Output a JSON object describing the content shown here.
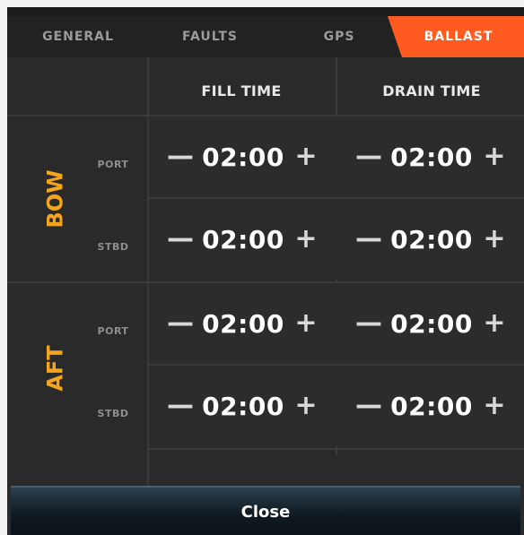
{
  "tabs": [
    {
      "label": "GENERAL",
      "active": false
    },
    {
      "label": "FAULTS",
      "active": false
    },
    {
      "label": "GPS",
      "active": false
    },
    {
      "label": "BALLAST",
      "active": true
    }
  ],
  "columns": {
    "fill": "FILL TIME",
    "drain": "DRAIN TIME"
  },
  "groups": {
    "bow": {
      "label": "BOW",
      "rows": [
        {
          "label": "PORT",
          "fill": "02:00",
          "drain": "02:00"
        },
        {
          "label": "STBD",
          "fill": "02:00",
          "drain": "02:00"
        }
      ]
    },
    "aft": {
      "label": "AFT",
      "rows": [
        {
          "label": "PORT",
          "fill": "02:00",
          "drain": "02:00"
        },
        {
          "label": "STBD",
          "fill": "02:00",
          "drain": "02:00"
        }
      ]
    }
  },
  "stepper": {
    "minus": "—",
    "plus": "+"
  },
  "close_label": "Close",
  "colors": {
    "accent": "#ff5a1f",
    "group_label": "#f4a51b",
    "panel": "#2a2a2a"
  }
}
